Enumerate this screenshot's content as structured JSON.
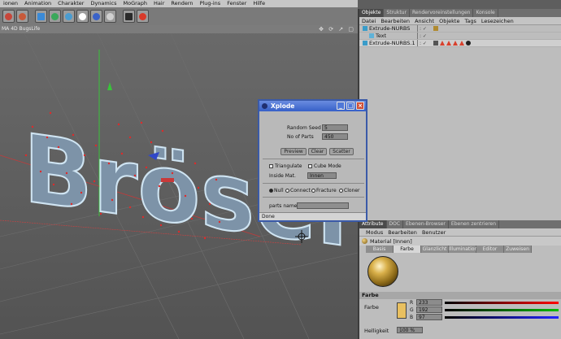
{
  "menubar": [
    "ionen",
    "Animation",
    "Charakter",
    "Dynamics",
    "MoGraph",
    "Hair",
    "Rendern",
    "Plug-ins",
    "Fenster",
    "Hilfe"
  ],
  "toolbar": [
    {
      "icon": "render-region-icon",
      "color": "#c8463a"
    },
    {
      "icon": "render-active-icon",
      "color": "#c85a3a"
    },
    {
      "icon": "cube-primitive-icon",
      "color": "#3a8ad8"
    },
    {
      "icon": "bend-icon",
      "color": "#3aa85a"
    },
    {
      "icon": "nurbs-icon",
      "color": "#4a9cd0"
    },
    {
      "icon": "array-icon",
      "color": "#ffffff"
    },
    {
      "icon": "deformer-icon",
      "color": "#3a62c8"
    },
    {
      "icon": "material-icon",
      "color": "#d0d0d0"
    },
    {
      "icon": "camera-icon",
      "color": "#2a2a2a"
    },
    {
      "icon": "light-icon",
      "color": "#d83a2a"
    }
  ],
  "viewport": {
    "title": "MA 4D BugsLife",
    "controls": "✥ ⟳ ↗ ▢"
  },
  "scene_text": "Brösel",
  "object_manager": {
    "tabs": [
      "Objekte",
      "Struktur",
      "Rendervoreinstellungen",
      "Konsole"
    ],
    "active_tab": "Objekte",
    "menu": [
      "Datei",
      "Bearbeiten",
      "Ansicht",
      "Objekte",
      "Tags",
      "Lesezeichen"
    ],
    "objects": [
      {
        "name": "Extrude-NURBS",
        "indent": 0
      },
      {
        "name": "Text",
        "indent": 1
      },
      {
        "name": "Extrude-NURBS.1",
        "indent": 0
      }
    ]
  },
  "attribute_manager": {
    "tabs": [
      "Attribute",
      "DOC",
      "Ebenen-Browser",
      "Ebenen zentrieren"
    ],
    "active_tab": "Attribute",
    "menu": [
      "Modus",
      "Bearbeiten",
      "Benutzer"
    ],
    "material_title": "Material [Innen]",
    "mat_tabs": [
      "Basis",
      "Farbe",
      "Glanzlicht",
      "Illumination",
      "Editor",
      "Zuweisen"
    ],
    "active_mat_tab": "Farbe",
    "section": "Farbe",
    "color_label": "Farbe",
    "swatch": "#e9c060",
    "r": "233",
    "g": "192",
    "b": "97",
    "brightness_label": "Helligkeit",
    "brightness": "100 %"
  },
  "xplode": {
    "title": "Xplode",
    "random_seed_label": "Random Seed",
    "random_seed": "5",
    "parts_label": "No of Parts",
    "parts": "450",
    "preview": "Preview",
    "clear": "Clear",
    "scatter": "Scatter",
    "triangulate": "Triangulate",
    "cube_mode": "Cube Mode",
    "inside_mat_label": "Inside Mat.",
    "inside_mat": "Innen",
    "radio_null": "Null",
    "radio_connect": "Connect",
    "radio_fracture": "Fracture",
    "radio_cloner": "Cloner",
    "parts_name_label": "parts name",
    "parts_name": "",
    "status": "Done"
  }
}
